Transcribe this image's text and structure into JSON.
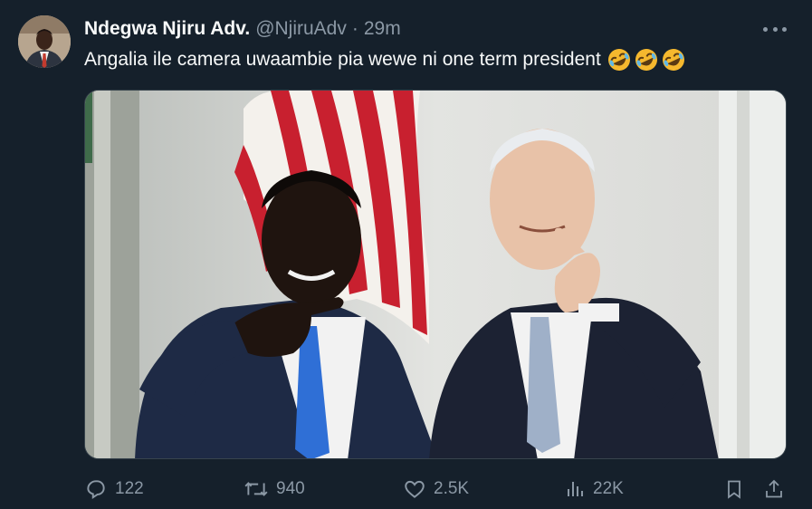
{
  "tweet": {
    "display_name": "Ndegwa Njiru Adv.",
    "handle": "@NjiruAdv",
    "separator": "·",
    "time": "29m",
    "text": "Angalia ile camera uwaambie pia wewe ni one term president",
    "emojis": [
      "rolling-on-floor-laughing-emoji",
      "rolling-on-floor-laughing-emoji",
      "rolling-on-floor-laughing-emoji"
    ]
  },
  "actions": {
    "replies": "122",
    "reposts": "940",
    "likes": "2.5K",
    "views": "22K"
  },
  "icons": {
    "more": "more-horizontal-icon",
    "reply": "reply-icon",
    "repost": "repost-icon",
    "like": "heart-icon",
    "views": "views-icon",
    "bookmark": "bookmark-icon",
    "share": "share-icon"
  },
  "colors": {
    "background": "#15202b",
    "primary_text": "#f7f9f9",
    "secondary_text": "#8b98a5",
    "emoji": "#f5b82e"
  }
}
